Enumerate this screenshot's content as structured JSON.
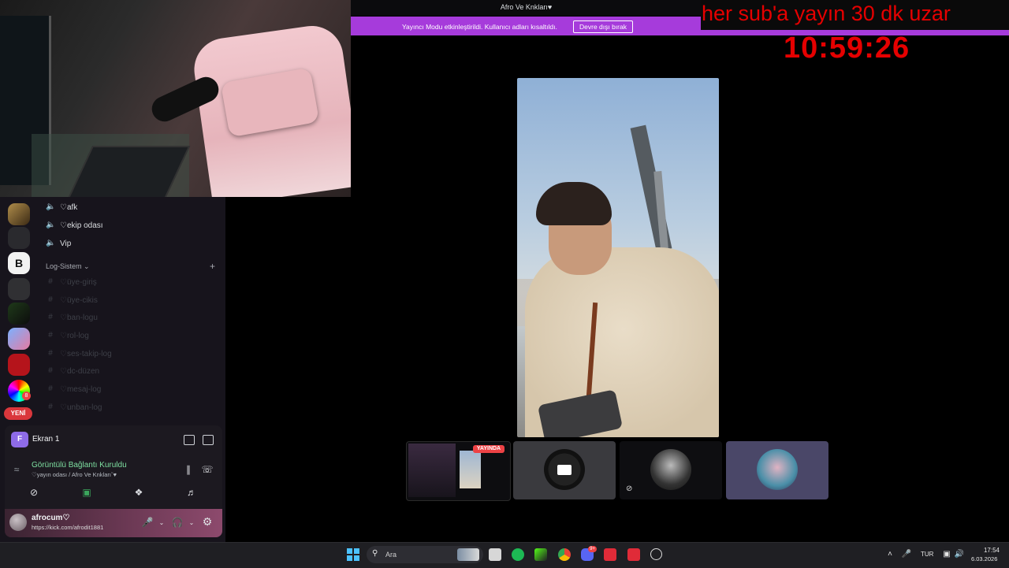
{
  "window": {
    "title": "Afro Ve Knkları♥",
    "streamer_mode_text": "Yayıncı Modu etkinleştirildi. Kullanıcı adları kısaltıldı.",
    "streamer_mode_button": "Devre dışı bırak"
  },
  "overlay": {
    "banner_text": "her sub'a yayın 30 dk uzar",
    "timer": "10:59:26",
    "color": "#e50000"
  },
  "sidebar": {
    "voice_channels": [
      {
        "label": "♡afk"
      },
      {
        "label": "♡ekip odası"
      },
      {
        "label": "Vip"
      }
    ],
    "category": {
      "label": "Log-Sistem",
      "plus": "+"
    },
    "log_channels": [
      {
        "label": "♡üye-giriş"
      },
      {
        "label": "♡üye-cikis"
      },
      {
        "label": "♡ban-logu"
      },
      {
        "label": "♡rol-log"
      },
      {
        "label": "♡ses-takip-log"
      },
      {
        "label": "♡dc-düzen"
      },
      {
        "label": "♡mesaj-log"
      },
      {
        "label": "♡unban-log"
      }
    ],
    "new_badge": "YENİ",
    "server_badge": "8"
  },
  "voice_panel": {
    "stream_title": "Ekran 1",
    "stream_icon_letter": "F",
    "connection_status": "Görüntülü Bağlantı Kuruldu",
    "connection_sub": "♡yayın odası / Afro Ve Knklarıˇ♥"
  },
  "user": {
    "name": "afrocum♡",
    "status": "https://kick.com/afrodit1881"
  },
  "stream_tiles": {
    "live_badge": "YAYINDA"
  },
  "taskbar": {
    "search_placeholder": "Ara",
    "language": "TUR",
    "time": "17:54",
    "date": "6.03.2026",
    "discord_badge": "9+"
  },
  "colors": {
    "accent_purple": "#a63bdb",
    "live_red": "#ed4245",
    "connected_green": "#7ee0a1"
  }
}
